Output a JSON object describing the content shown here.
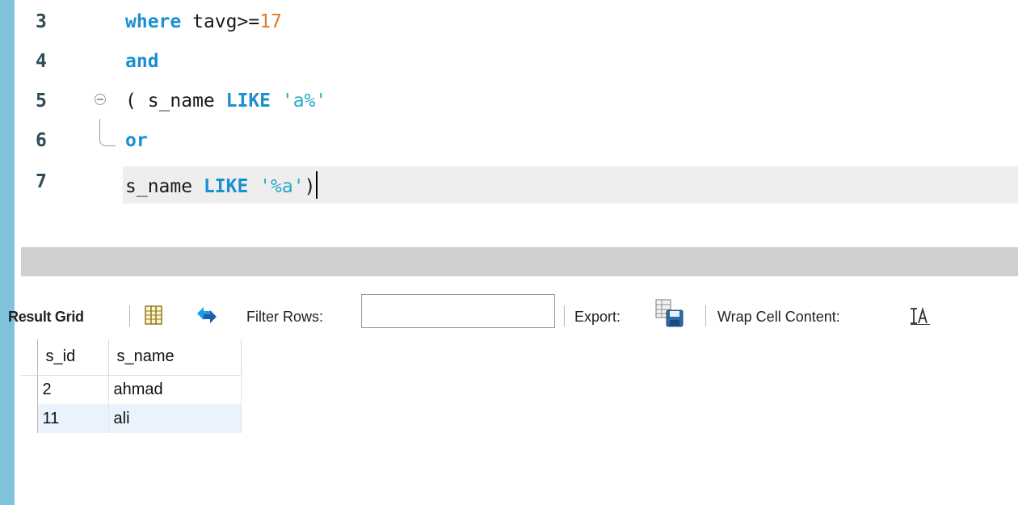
{
  "editor": {
    "lines": [
      {
        "number": "3",
        "tokens": [
          {
            "type": "kw",
            "text": "where"
          },
          {
            "type": "op",
            "text": " tavg>="
          },
          {
            "type": "num",
            "text": "17"
          }
        ]
      },
      {
        "number": "4",
        "tokens": [
          {
            "type": "kw",
            "text": "and"
          }
        ]
      },
      {
        "number": "5",
        "tokens": [
          {
            "type": "op",
            "text": "( s_name "
          },
          {
            "type": "kw",
            "text": "LIKE"
          },
          {
            "type": "op",
            "text": " "
          },
          {
            "type": "str",
            "text": "'a%'"
          }
        ]
      },
      {
        "number": "6",
        "tokens": [
          {
            "type": "kw",
            "text": "or"
          }
        ]
      },
      {
        "number": "7",
        "tokens": [
          {
            "type": "op",
            "text": "s_name "
          },
          {
            "type": "kw",
            "text": "LIKE"
          },
          {
            "type": "op",
            "text": " "
          },
          {
            "type": "str",
            "text": "'%a'"
          },
          {
            "type": "op",
            "text": ")"
          }
        ]
      }
    ],
    "current_line_index": 4,
    "fold_line_index": 2
  },
  "toolbar": {
    "result_grid_label": "Result Grid",
    "filter_label": "Filter Rows:",
    "filter_value": "",
    "export_label": "Export:",
    "wrap_label": "Wrap Cell Content:",
    "icons": {
      "grid": "grid-layout-icon",
      "refresh": "refresh-icon",
      "export": "export-save-icon",
      "wrap": "wrap-text-icon"
    }
  },
  "results": {
    "columns": [
      "s_id",
      "s_name"
    ],
    "rows": [
      [
        "2",
        "ahmad"
      ],
      [
        "11",
        "ali"
      ]
    ]
  },
  "colors": {
    "keyword": "#1b8fd1",
    "number": "#e07b1f",
    "string": "#2aa8c8",
    "accent_strip": "#7ec3d9"
  }
}
